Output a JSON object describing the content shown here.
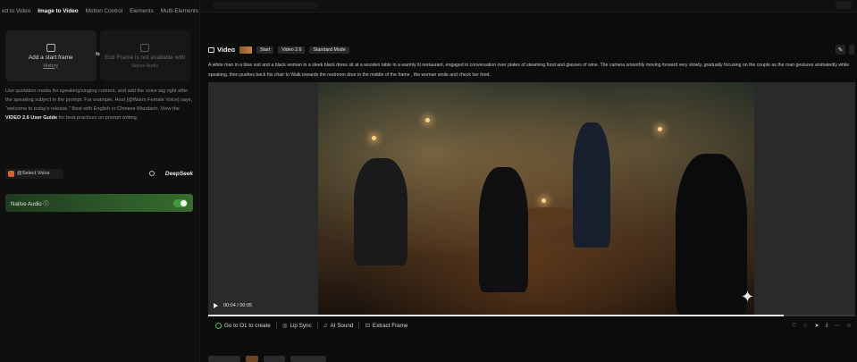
{
  "tabs": [
    "ed to Video",
    "Image to Video",
    "Motion Control",
    "Elements",
    "Multi-Elements"
  ],
  "active_tab": 1,
  "start_frame": {
    "label": "Add a start frame",
    "sub": "History"
  },
  "end_frame": {
    "label": "End Frame is not available with",
    "sub": "Native Audio"
  },
  "swap_label": "⇆",
  "prompt": {
    "text": "Use quotation marks for speaking/singing content, and add the voice tag right after the speaking subject in the prompt. For example, Host [@Warm Female Voice] says, \"welcome to today's release.\" Best with English or Chinese Mandarin. View the",
    "guide": "VIDEO 2.6 User Guide",
    "after": " for best practices on prompt writing."
  },
  "voice": {
    "select_label": "@Select Voice",
    "brand": "DeepSeek"
  },
  "native_audio": {
    "label": "Native Audio ⓘ",
    "enabled": true
  },
  "video": {
    "title": "Video",
    "tags": [
      "Start",
      "Video 2.6",
      "Standard Mode"
    ],
    "description": "A white man in a blue suit and a black woman in a sleek black dress sit at a wooden table in a warmly lit restaurant, engaged in conversation over plates of steaming food and glasses of wine. The camera smoothly moving forward very slowly, gradually focusing on the couple as the man gestures animatedly while speaking, then pushes back his chair to Walk towards the restroom door in the middle of the frame , the woman smile and check her food.",
    "timecode": "00:04 / 00:05",
    "progress": 0.89
  },
  "actions": [
    {
      "label": "Go to O1 to create",
      "icon": "go-icon"
    },
    {
      "label": "Lip Sync",
      "icon": "lip-sync-icon"
    },
    {
      "label": "AI Sound",
      "icon": "ai-sound-icon"
    },
    {
      "label": "Extract Frame",
      "icon": "extract-frame-icon"
    }
  ],
  "right_action_icons": [
    "like-icon",
    "dislike-icon",
    "share-icon",
    "download-icon",
    "more-icon",
    "favorite-icon"
  ]
}
